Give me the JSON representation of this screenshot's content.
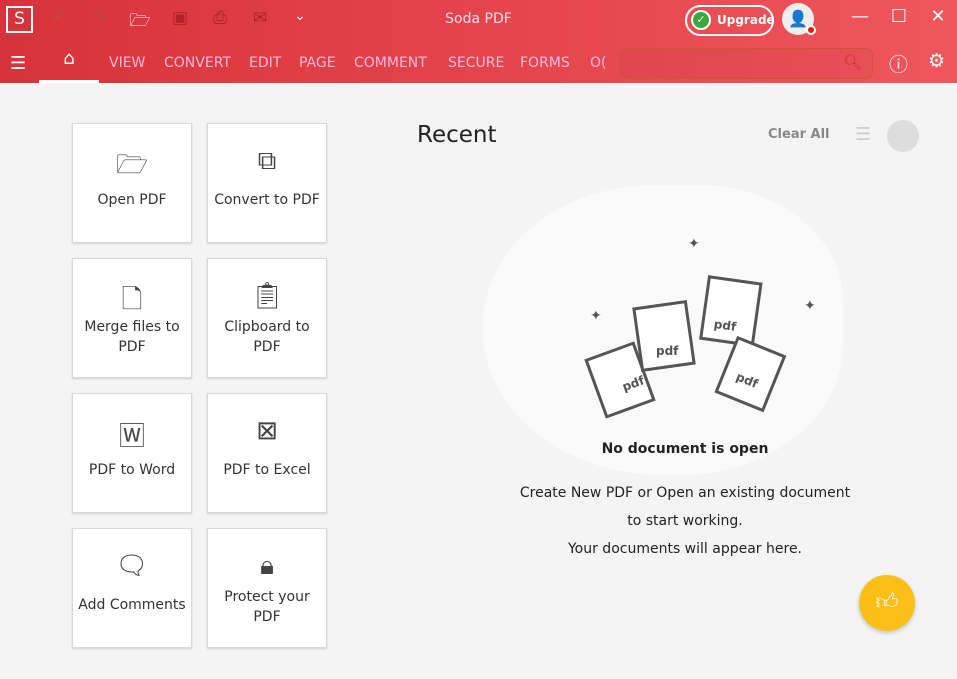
{
  "app": {
    "title": "Soda PDF",
    "logo": "S",
    "upgrade": "Upgrade",
    "accent": "#e0393f"
  },
  "tabs": [
    "VIEW",
    "CONVERT",
    "EDIT",
    "PAGE",
    "COMMENT",
    "SECURE",
    "FORMS",
    "O("
  ],
  "search": {
    "placeholder": ""
  },
  "tiles": [
    {
      "label": "Open PDF",
      "icon": "folder-open-icon"
    },
    {
      "label": "Convert to PDF",
      "icon": "convert-icon"
    },
    {
      "label": "Merge files to PDF",
      "icon": "merge-icon"
    },
    {
      "label": "Clipboard to PDF",
      "icon": "clipboard-icon"
    },
    {
      "label": "PDF to Word",
      "icon": "word-icon"
    },
    {
      "label": "PDF to Excel",
      "icon": "excel-icon"
    },
    {
      "label": "Add Comments",
      "icon": "comment-icon"
    },
    {
      "label": "Protect your PDF",
      "icon": "lock-icon"
    }
  ],
  "recent": {
    "title": "Recent",
    "clear_all": "Clear All",
    "empty_title": "No document is open",
    "empty_lines": [
      "Create New PDF or Open an existing document",
      "to start working.",
      "Your documents will appear here."
    ],
    "pdf_label": "pdf"
  }
}
